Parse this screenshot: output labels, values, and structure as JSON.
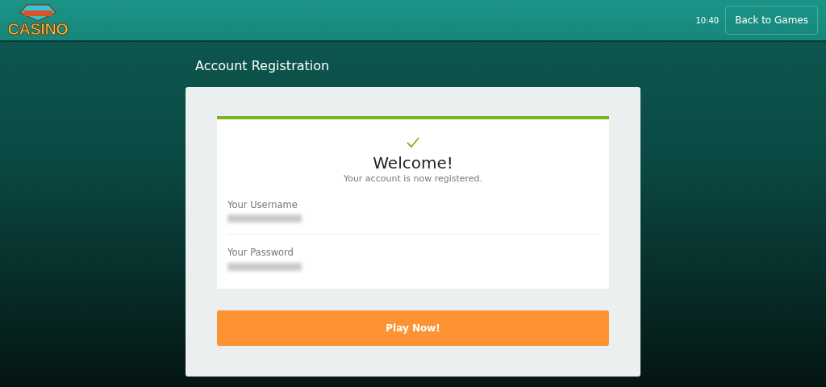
{
  "header": {
    "logo": {
      "text": "CASINO"
    },
    "time": "10:40",
    "back_button": "Back to Games"
  },
  "page_title": "Account Registration",
  "confirmation": {
    "success": true,
    "heading": "Welcome!",
    "message": "Your account is now registered.",
    "fields": [
      {
        "label": "Your Username",
        "blurred": true
      },
      {
        "label": "Your Password",
        "blurred": true
      }
    ]
  },
  "play_button": "Play Now!"
}
